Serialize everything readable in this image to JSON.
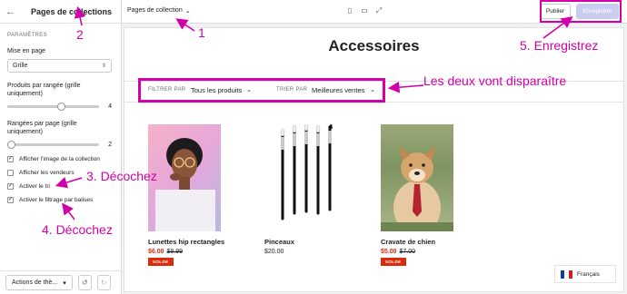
{
  "sidebar": {
    "back_icon": "back-arrow-icon",
    "title": "Pages de collections",
    "section": "PARAMÈTRES",
    "layout_label": "Mise en page",
    "layout_value": "Grille",
    "products_per_row_label": "Produits par rangée (grille uniquement)",
    "products_per_row_value": "4",
    "products_per_row_fraction": 0.6,
    "rows_per_page_label": "Rangées par page (grille uniquement)",
    "rows_per_page_value": "2",
    "rows_per_page_fraction": 0.0,
    "checkboxes": [
      {
        "label": "Afficher l'image de la collection",
        "checked": true
      },
      {
        "label": "Afficher les vendeurs",
        "checked": false
      },
      {
        "label": "Activer le tri",
        "checked": true
      },
      {
        "label": "Activer le filtrage par balises",
        "checked": true
      }
    ],
    "footer_actions": "Actions de thè...",
    "undo_icon": "undo-icon",
    "redo_icon": "redo-icon"
  },
  "topbar": {
    "page_selector": "Pages de collection",
    "devices": [
      "mobile-icon",
      "desktop-icon",
      "fullscreen-icon"
    ],
    "publish": "Publier",
    "save": "Enregistrer"
  },
  "preview": {
    "title": "Accessoires",
    "filter_label": "FILTRER PAR",
    "filter_value": "Tous les produits",
    "sort_label": "TRIER PAR",
    "sort_value": "Meilleures ventes",
    "products": [
      {
        "name": "Lunettes hip rectangles",
        "sale_price": "$6.00",
        "old_price": "$8.99",
        "badge": "SOLDE"
      },
      {
        "name": "Pinceaux",
        "price": "$20.00"
      },
      {
        "name": "Cravate de chien",
        "sale_price": "$5.00",
        "old_price": "$7.00",
        "badge": "SOLDE"
      }
    ],
    "language": "Français"
  },
  "annotations": {
    "a1": "1",
    "a2": "2",
    "a3": "3. Décochez",
    "a4": "4. Décochez",
    "a5": "5. Enregistrez",
    "filters_note": "Les deux vont disparaître"
  },
  "colors": {
    "annotation": "#d100a8",
    "sale": "#d82c0d",
    "save_button": "#c9cdf0"
  }
}
